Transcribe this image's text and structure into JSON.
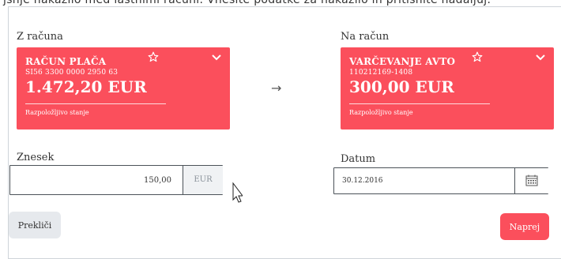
{
  "top_text": "jšnje nakazilo med lastnimi računi. Vnesite podatke za nakazilo in pritisnite nadaljuj.",
  "from": {
    "label": "Z računa",
    "account_name": "RAČUN PLAČA",
    "iban": "SI56 3300 0000 2950 63",
    "balance": "1.472,20 EUR",
    "balance_label": "Razpoložljivo stanje",
    "star_icon": "star-outline-icon",
    "dropdown_icon": "chevron-down-icon"
  },
  "transfer_arrow": "→",
  "to": {
    "label": "Na račun",
    "account_name": "VARČEVANJE AVTO",
    "account_number": "110212169-1408",
    "balance": "300,00 EUR",
    "balance_label": "Razpoložljivo stanje",
    "star_icon": "star-outline-icon",
    "dropdown_icon": "chevron-down-icon"
  },
  "amount": {
    "label": "Znesek",
    "value": "150,00",
    "currency": "EUR"
  },
  "date": {
    "label": "Datum",
    "value": "30.12.2016",
    "calendar_icon": "calendar-icon"
  },
  "actions": {
    "cancel_label": "Prekliči",
    "next_label": "Naprej"
  },
  "colors": {
    "card_red": "#fb4f5c",
    "button_grey": "#e6e9ed",
    "border": "#4b5258"
  }
}
